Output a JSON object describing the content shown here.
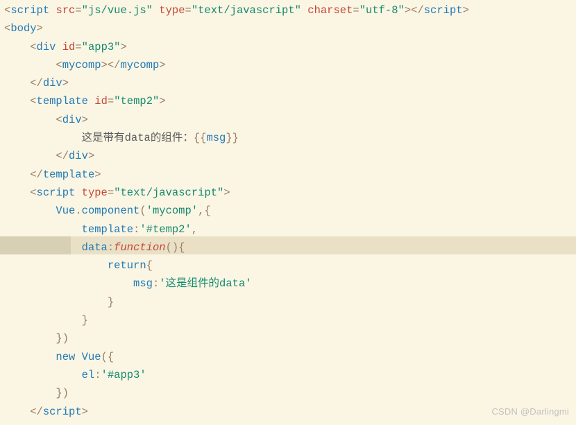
{
  "lines": [
    [
      {
        "c": "p",
        "t": "<"
      },
      {
        "c": "tag",
        "t": "script"
      },
      {
        "c": "txt",
        "t": " "
      },
      {
        "c": "attr",
        "t": "src"
      },
      {
        "c": "p",
        "t": "="
      },
      {
        "c": "str",
        "t": "\"js/vue.js\""
      },
      {
        "c": "txt",
        "t": " "
      },
      {
        "c": "attr",
        "t": "type"
      },
      {
        "c": "p",
        "t": "="
      },
      {
        "c": "str",
        "t": "\"text/javascript\""
      },
      {
        "c": "txt",
        "t": " "
      },
      {
        "c": "attr",
        "t": "charset"
      },
      {
        "c": "p",
        "t": "="
      },
      {
        "c": "str",
        "t": "\"utf-8\""
      },
      {
        "c": "p",
        "t": "></"
      },
      {
        "c": "tag",
        "t": "script"
      },
      {
        "c": "p",
        "t": ">"
      }
    ],
    [
      {
        "c": "p",
        "t": "<"
      },
      {
        "c": "tag",
        "t": "body"
      },
      {
        "c": "p",
        "t": ">"
      }
    ],
    [
      {
        "c": "txt",
        "t": "    "
      },
      {
        "c": "p",
        "t": "<"
      },
      {
        "c": "tag",
        "t": "div"
      },
      {
        "c": "txt",
        "t": " "
      },
      {
        "c": "attr",
        "t": "id"
      },
      {
        "c": "p",
        "t": "="
      },
      {
        "c": "str",
        "t": "\"app3\""
      },
      {
        "c": "p",
        "t": ">"
      }
    ],
    [
      {
        "c": "txt",
        "t": "        "
      },
      {
        "c": "p",
        "t": "<"
      },
      {
        "c": "tag",
        "t": "mycomp"
      },
      {
        "c": "p",
        "t": "></"
      },
      {
        "c": "tag",
        "t": "mycomp"
      },
      {
        "c": "p",
        "t": ">"
      }
    ],
    [
      {
        "c": "txt",
        "t": "    "
      },
      {
        "c": "p",
        "t": "</"
      },
      {
        "c": "tag",
        "t": "div"
      },
      {
        "c": "p",
        "t": ">"
      }
    ],
    [
      {
        "c": "txt",
        "t": "    "
      },
      {
        "c": "p",
        "t": "<"
      },
      {
        "c": "tag",
        "t": "template"
      },
      {
        "c": "txt",
        "t": " "
      },
      {
        "c": "attr",
        "t": "id"
      },
      {
        "c": "p",
        "t": "="
      },
      {
        "c": "str",
        "t": "\"temp2\""
      },
      {
        "c": "p",
        "t": ">"
      }
    ],
    [
      {
        "c": "txt",
        "t": "        "
      },
      {
        "c": "p",
        "t": "<"
      },
      {
        "c": "tag",
        "t": "div"
      },
      {
        "c": "p",
        "t": ">"
      }
    ],
    [
      {
        "c": "txt",
        "t": "            这是带有data的组件："
      },
      {
        "c": "p",
        "t": "{{"
      },
      {
        "c": "tag",
        "t": "msg"
      },
      {
        "c": "p",
        "t": "}}"
      }
    ],
    [
      {
        "c": "txt",
        "t": "        "
      },
      {
        "c": "p",
        "t": "</"
      },
      {
        "c": "tag",
        "t": "div"
      },
      {
        "c": "p",
        "t": ">"
      }
    ],
    [
      {
        "c": "txt",
        "t": "    "
      },
      {
        "c": "p",
        "t": "</"
      },
      {
        "c": "tag",
        "t": "template"
      },
      {
        "c": "p",
        "t": ">"
      }
    ],
    [
      {
        "c": "txt",
        "t": "    "
      },
      {
        "c": "p",
        "t": "<"
      },
      {
        "c": "tag",
        "t": "script"
      },
      {
        "c": "txt",
        "t": " "
      },
      {
        "c": "attr",
        "t": "type"
      },
      {
        "c": "p",
        "t": "="
      },
      {
        "c": "str",
        "t": "\"text/javascript\""
      },
      {
        "c": "p",
        "t": ">"
      }
    ],
    [
      {
        "c": "txt",
        "t": "        "
      },
      {
        "c": "tag",
        "t": "Vue"
      },
      {
        "c": "p",
        "t": "."
      },
      {
        "c": "tag",
        "t": "component"
      },
      {
        "c": "p",
        "t": "("
      },
      {
        "c": "str",
        "t": "'mycomp'"
      },
      {
        "c": "p",
        "t": ",{"
      }
    ],
    [
      {
        "c": "txt",
        "t": "            "
      },
      {
        "c": "tag",
        "t": "template"
      },
      {
        "c": "p",
        "t": ":"
      },
      {
        "c": "str",
        "t": "'#temp2'"
      },
      {
        "c": "p",
        "t": ","
      }
    ],
    [
      {
        "c": "txt",
        "t": "            "
      },
      {
        "c": "tag",
        "t": "data"
      },
      {
        "c": "p",
        "t": ":"
      },
      {
        "c": "kw",
        "t": "function"
      },
      {
        "c": "p",
        "t": "(){"
      }
    ],
    [
      {
        "c": "txt",
        "t": "                "
      },
      {
        "c": "tag",
        "t": "return"
      },
      {
        "c": "p",
        "t": "{"
      }
    ],
    [
      {
        "c": "txt",
        "t": "                    "
      },
      {
        "c": "tag",
        "t": "msg"
      },
      {
        "c": "p",
        "t": ":"
      },
      {
        "c": "str",
        "t": "'这是组件的data'"
      }
    ],
    [
      {
        "c": "txt",
        "t": "                "
      },
      {
        "c": "p",
        "t": "}"
      }
    ],
    [
      {
        "c": "txt",
        "t": "            "
      },
      {
        "c": "p",
        "t": "}"
      }
    ],
    [
      {
        "c": "txt",
        "t": "        "
      },
      {
        "c": "p",
        "t": "})"
      }
    ],
    [
      {
        "c": "txt",
        "t": "        "
      },
      {
        "c": "tag",
        "t": "new"
      },
      {
        "c": "txt",
        "t": " "
      },
      {
        "c": "tag",
        "t": "Vue"
      },
      {
        "c": "p",
        "t": "({"
      }
    ],
    [
      {
        "c": "txt",
        "t": "            "
      },
      {
        "c": "tag",
        "t": "el"
      },
      {
        "c": "p",
        "t": ":"
      },
      {
        "c": "str",
        "t": "'#app3'"
      }
    ],
    [
      {
        "c": "txt",
        "t": "        "
      },
      {
        "c": "p",
        "t": "})"
      }
    ],
    [
      {
        "c": "txt",
        "t": "    "
      },
      {
        "c": "p",
        "t": "</"
      },
      {
        "c": "tag",
        "t": "script"
      },
      {
        "c": "p",
        "t": ">"
      }
    ]
  ],
  "watermark": "CSDN @Darlingmi"
}
